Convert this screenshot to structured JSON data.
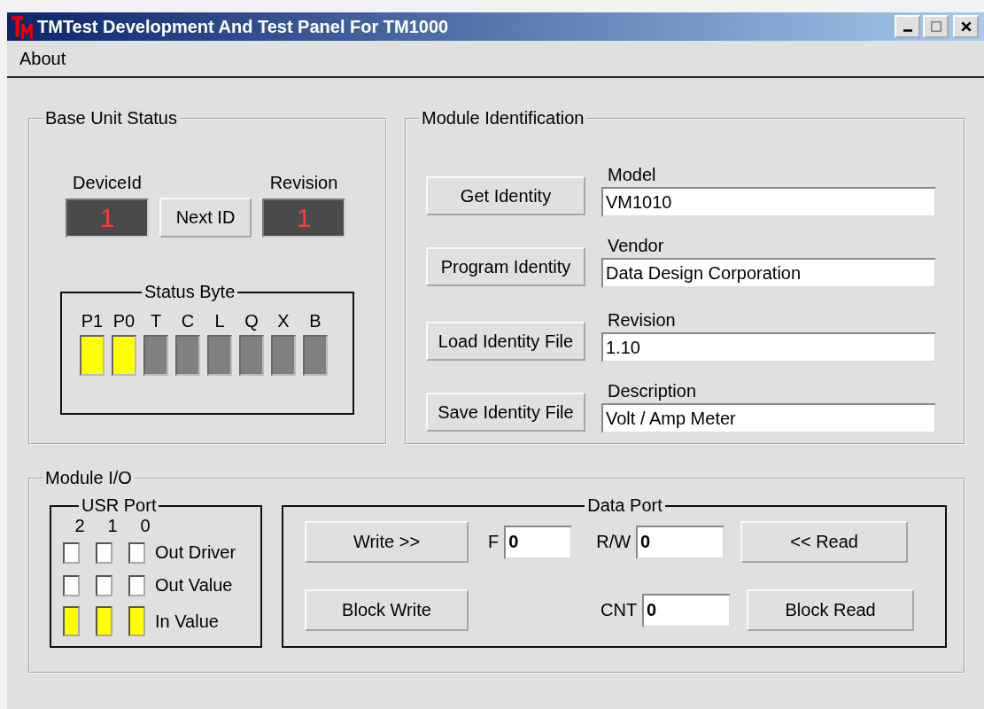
{
  "window": {
    "title": "TMTest Development And Test Panel For TM1000"
  },
  "menu": [
    {
      "label": "About"
    }
  ],
  "base_unit_status": {
    "title": "Base Unit Status",
    "device_id": {
      "label": "DeviceId",
      "value": "1"
    },
    "next_button": "Next ID",
    "revision": {
      "label": "Revision",
      "value": "1"
    },
    "status_byte": {
      "title": "Status Byte",
      "bits": [
        {
          "label": "P1",
          "on": true
        },
        {
          "label": "P0",
          "on": true
        },
        {
          "label": "T",
          "on": false
        },
        {
          "label": "C",
          "on": false
        },
        {
          "label": "L",
          "on": false
        },
        {
          "label": "Q",
          "on": false
        },
        {
          "label": "X",
          "on": false
        },
        {
          "label": "B",
          "on": false
        }
      ]
    }
  },
  "module_identification": {
    "title": "Module Identification",
    "rows": [
      {
        "button": "Get Identity",
        "label": "Model",
        "value": "VM1010"
      },
      {
        "button": "Program Identity",
        "label": "Vendor",
        "value": "Data Design Corporation"
      },
      {
        "button": "Load Identity File",
        "label": "Revision",
        "value": "1.10"
      },
      {
        "button": "Save Identity File",
        "label": "Description",
        "value": "Volt / Amp Meter"
      }
    ]
  },
  "module_io": {
    "title": "Module I/O",
    "usr_port": {
      "title": "USR Port",
      "bit_labels": [
        "2",
        "1",
        "0"
      ],
      "rows": [
        {
          "kind": "checkbox",
          "label": "Out Driver",
          "bits": [
            {
              "checked": false
            },
            {
              "checked": false
            },
            {
              "checked": false
            }
          ]
        },
        {
          "kind": "checkbox",
          "label": "Out Value",
          "bits": [
            {
              "checked": false
            },
            {
              "checked": false
            },
            {
              "checked": false
            }
          ]
        },
        {
          "kind": "indicator",
          "label": "In Value",
          "bits": [
            {
              "on": true
            },
            {
              "on": true
            },
            {
              "on": true
            }
          ]
        }
      ]
    },
    "data_port": {
      "title": "Data Port",
      "write_button": "Write >>",
      "block_write_button": "Block Write",
      "f": {
        "label": "F",
        "value": "0"
      },
      "rw": {
        "label": "R/W",
        "value": "0"
      },
      "cnt": {
        "label": "CNT",
        "value": "0"
      },
      "read_button": "<< Read",
      "block_read_button": "Block Read"
    }
  }
}
